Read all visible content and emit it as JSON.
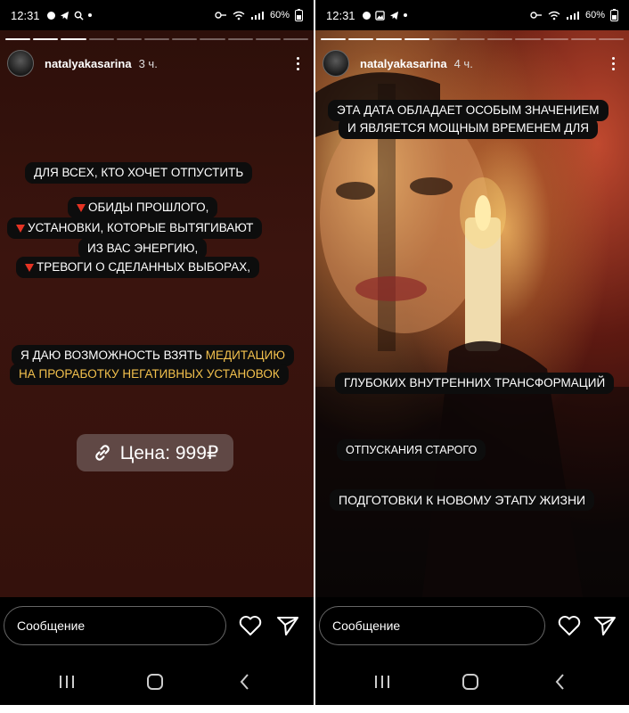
{
  "left": {
    "status": {
      "time": "12:31",
      "battery": "60%"
    },
    "header": {
      "username": "natalyakasarina",
      "ago": "3 ч."
    },
    "labels": {
      "line1": "ДЛЯ ВСЕХ, КТО ХОЧЕТ ОТПУСТИТЬ",
      "item1": "ОБИДЫ ПРОШЛОГО,",
      "item2": "УСТАНОВКИ, КОТОРЫЕ ВЫТЯГИВАЮТ",
      "item2b": "ИЗ ВАС ЭНЕРГИЮ,",
      "item3": "ТРЕВОГИ О СДЕЛАННЫХ ВЫБОРАХ,",
      "offer_a": "Я ДАЮ ВОЗМОЖНОСТЬ ВЗЯТЬ ",
      "offer_b": "МЕДИТАЦИЮ",
      "offer_c": "НА ПРОРАБОТКУ НЕГАТИВНЫХ УСТАНОВОК"
    },
    "price": "Цена: 999₽",
    "message_placeholder": "Сообщение"
  },
  "right": {
    "status": {
      "time": "12:31",
      "battery": "60%"
    },
    "header": {
      "username": "natalyakasarina",
      "ago": "4 ч."
    },
    "labels": {
      "top1": "ЭТА ДАТА ОБЛАДАЕТ ОСОБЫМ ЗНАЧЕНИЕМ",
      "top2": "И ЯВЛЯЕТСЯ МОЩНЫМ ВРЕМЕНЕМ ДЛЯ",
      "deep": "ГЛУБОКИХ ВНУТРЕННИХ ТРАНСФОРМАЦИЙ",
      "release": "ОТПУСКАНИЯ СТАРОГО",
      "prepare": "ПОДГОТОВКИ К НОВОМУ ЭТАПУ ЖИЗНИ"
    },
    "message_placeholder": "Сообщение"
  },
  "colors": {
    "accent_gold": "#f3c14d",
    "triangle_red": "#e53323"
  },
  "icons": [
    "link-icon",
    "heart-icon",
    "send-icon",
    "more-icon",
    "recent-apps-icon",
    "home-icon",
    "back-icon"
  ]
}
